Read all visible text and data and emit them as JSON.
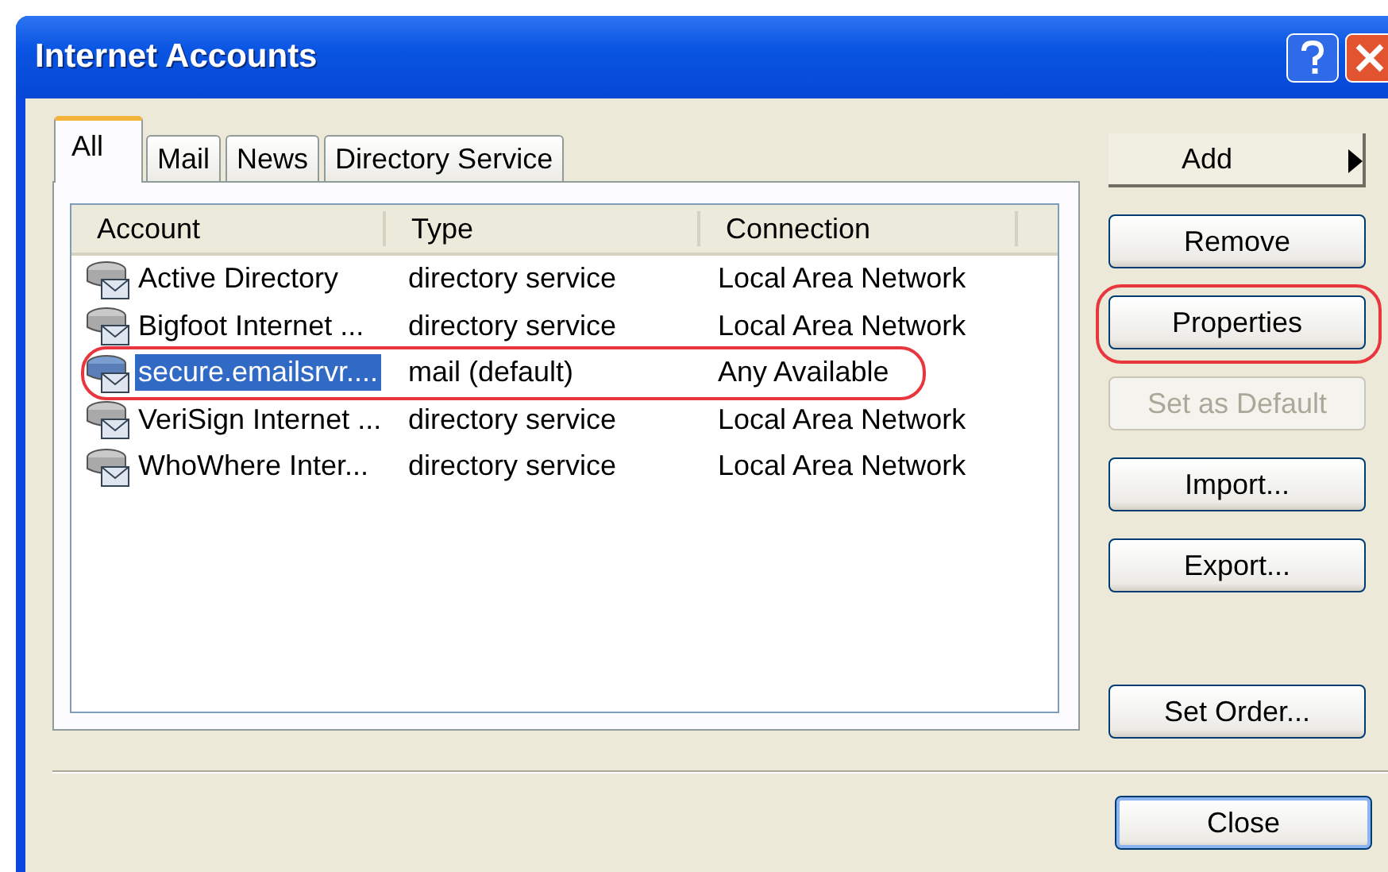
{
  "window": {
    "title": "Internet Accounts"
  },
  "tabs": [
    {
      "label": "All",
      "selected": true
    },
    {
      "label": "Mail",
      "selected": false
    },
    {
      "label": "News",
      "selected": false
    },
    {
      "label": "Directory Service",
      "selected": false
    }
  ],
  "table": {
    "columns": [
      "Account",
      "Type",
      "Connection"
    ],
    "rows": [
      {
        "account": "Active Directory",
        "type": "directory service",
        "connection": "Local Area Network",
        "selected": false,
        "circled": false,
        "kind": "directory"
      },
      {
        "account": "Bigfoot Internet ...",
        "type": "directory service",
        "connection": "Local Area Network",
        "selected": false,
        "circled": false,
        "kind": "directory"
      },
      {
        "account": "secure.emailsrvr....",
        "type": "mail (default)",
        "connection": "Any Available",
        "selected": true,
        "circled": true,
        "kind": "mail"
      },
      {
        "account": "VeriSign Internet ...",
        "type": "directory service",
        "connection": "Local Area Network",
        "selected": false,
        "circled": false,
        "kind": "directory"
      },
      {
        "account": "WhoWhere Inter...",
        "type": "directory service",
        "connection": "Local Area Network",
        "selected": false,
        "circled": false,
        "kind": "directory"
      }
    ]
  },
  "buttons": [
    {
      "label": "Add",
      "kind": "menu"
    },
    {
      "label": "Remove",
      "kind": "push",
      "disabled": false,
      "circled": false
    },
    {
      "label": "Properties",
      "kind": "push",
      "disabled": false,
      "circled": true
    },
    {
      "label": "Set as Default",
      "kind": "push",
      "disabled": true,
      "circled": false
    },
    {
      "label": "Import...",
      "kind": "push",
      "disabled": false,
      "circled": false
    },
    {
      "label": "Export...",
      "kind": "push",
      "disabled": false,
      "circled": false
    },
    {
      "label": "Set Order...",
      "kind": "push",
      "disabled": false,
      "circled": false
    }
  ],
  "footer_button": {
    "label": "Close",
    "default": true
  }
}
